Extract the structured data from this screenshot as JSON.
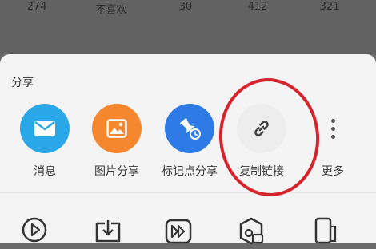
{
  "stats": [
    "274",
    "不喜欢",
    "30",
    "412",
    "321"
  ],
  "sheet": {
    "title": "分享",
    "share_items": [
      {
        "label": "消息",
        "icon": "mail-icon",
        "color": "#2aa7e8"
      },
      {
        "label": "图片分享",
        "icon": "image-icon",
        "color": "#f5872f"
      },
      {
        "label": "标记点分享",
        "icon": "pin-clock-icon",
        "color": "#2f7be6"
      },
      {
        "label": "复制链接",
        "icon": "link-icon",
        "color": "#ededed"
      },
      {
        "label": "更多",
        "icon": "more-vertical-icon"
      }
    ],
    "actions": [
      {
        "icon": "replay-icon"
      },
      {
        "icon": "download-icon"
      },
      {
        "icon": "fast-forward-icon"
      },
      {
        "icon": "settings-screen-icon"
      },
      {
        "icon": "phone-icon"
      }
    ]
  },
  "colors": {
    "overlay": "#6a6a6a",
    "sheet_bg": "#f4f4f4",
    "highlight": "#d8232d"
  }
}
